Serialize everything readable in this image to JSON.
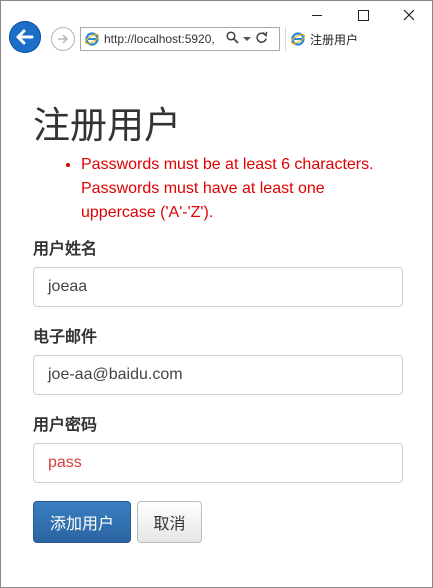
{
  "browser": {
    "address_url": "http://localhost:5920,",
    "tab_title": "注册用户"
  },
  "page": {
    "title": "注册用户",
    "errors": [
      "Passwords must be at least 6 characters.",
      "Passwords must have at least one uppercase ('A'-'Z')."
    ]
  },
  "form": {
    "username_label": "用户姓名",
    "username_value": "joeaa",
    "email_label": "电子邮件",
    "email_value": "joe-aa@baidu.com",
    "password_label": "用户密码",
    "password_value": "pass"
  },
  "buttons": {
    "submit_label": "添加用户",
    "cancel_label": "取消"
  },
  "colors": {
    "error": "#e00000",
    "primary": "#2a64a0",
    "ie_blue": "#1b6fc8"
  }
}
